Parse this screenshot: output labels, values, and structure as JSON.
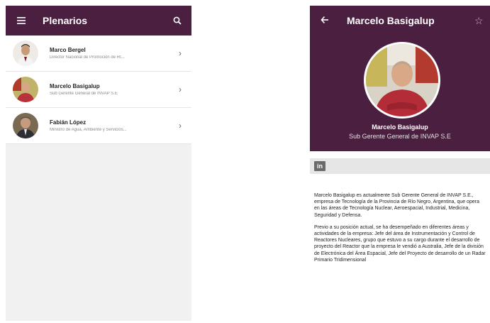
{
  "colors": {
    "appbar": "#4a1f3f",
    "list_bg": "#f1f1f1"
  },
  "list_screen": {
    "title": "Plenarios",
    "menu_icon": "hamburger-menu-icon",
    "search_icon": "search-icon",
    "items": [
      {
        "name": "Marco Bergel",
        "role": "Director Nacional de Promoción de RI..."
      },
      {
        "name": "Marcelo Basigalup",
        "role": "Sub Gerente General de INVAP S.E"
      },
      {
        "name": "Fabián López",
        "role": "Ministro de Agua, Ambiente y Servicios..."
      }
    ]
  },
  "detail_screen": {
    "title": "Marcelo Basigalup",
    "name": "Marcelo Basigalup",
    "role": "Sub Gerente General de INVAP S.E",
    "social_label": "in",
    "bio_p1": "Marcelo Basigalup es actualmente Sub Gerente General de INVAP S.E., empresa de Tecnología de la Provincia de Río Negro, Argentina, que opera en las áreas de Tecnología Nuclear, Aeroespacial, Industrial, Medicina, Seguridad y Defensa.",
    "bio_p2": "Previo a su posición actual, se ha desempeñado en diferentes áreas y actividades de la empresa: Jefe del área de Instrumentación y Control de Reactores Nucleares, grupo que estuvo a su cargo durante el desarrollo de proyecto del Reactor que la empresa le vendió a Australia, Jefe de la división de Electrónica del Área Espacial, Jefe del Proyecto de desarrollo de un Radar Primario Tridimensional"
  }
}
